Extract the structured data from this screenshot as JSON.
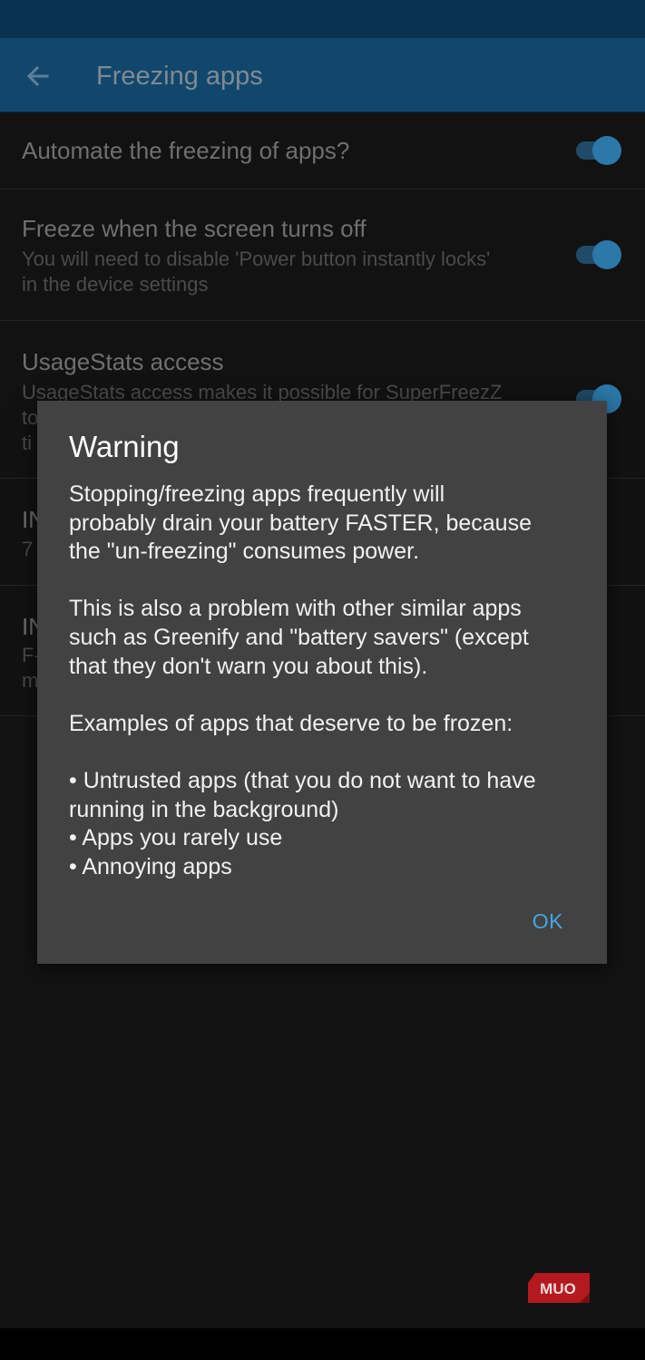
{
  "app_bar": {
    "title": "Freezing apps",
    "back_icon": "arrow-left-icon"
  },
  "preferences": [
    {
      "title": "Automate the freezing of apps?",
      "summary": [],
      "toggle_on": true
    },
    {
      "title": "Freeze when the screen turns off",
      "summary": [
        "You will need to disable 'Power button instantly locks'",
        "in the device settings"
      ],
      "toggle_on": true
    },
    {
      "title": "UsageStats access",
      "summary": [
        "UsageStats access makes it possible for SuperFreezZ",
        "to",
        "ti"
      ],
      "toggle_on": true
    },
    {
      "title": "IN",
      "summary": [
        "7"
      ]
    },
    {
      "title": "IN",
      "summary": [
        "F-",
        "m"
      ]
    }
  ],
  "dialog": {
    "title": "Warning",
    "paragraphs": [
      "Stopping/freezing apps frequently will",
      "probably drain your battery FASTER, because",
      "the \"un-freezing\" consumes power.",
      "",
      "This is also a problem with other similar apps",
      "such as Greenify and \"battery savers\" (except",
      "that they don't warn you about this).",
      "",
      "Examples of apps that deserve to be frozen:",
      "",
      "• Untrusted apps (that you do not want to have",
      "running in the background)",
      "• Apps you rarely use",
      "• Annoying apps"
    ],
    "ok_label": "OK"
  },
  "watermark": {
    "text": "MUO"
  },
  "colors": {
    "status_bar": "#0a3250",
    "app_bar": "#12476d",
    "dialog_bg": "#424242",
    "accent": "#41a7e0",
    "background": "#111111"
  }
}
